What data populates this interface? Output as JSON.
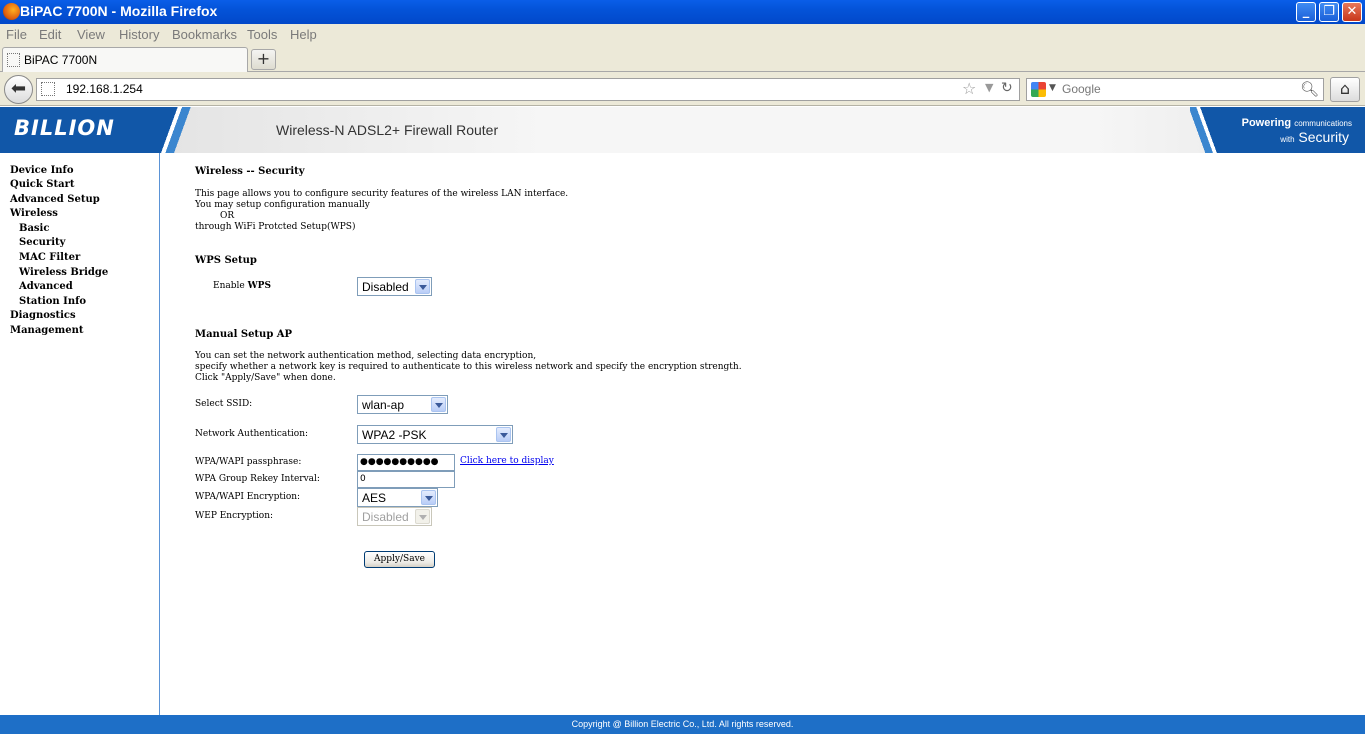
{
  "window": {
    "title": "BiPAC 7700N - Mozilla Firefox"
  },
  "menubar": {
    "items": [
      "File",
      "Edit",
      "View",
      "History",
      "Bookmarks",
      "Tools",
      "Help"
    ]
  },
  "tabs": [
    {
      "label": "BiPAC 7700N"
    }
  ],
  "newtab_label": "+",
  "navbar": {
    "url": "192.168.1.254",
    "search_placeholder": "Google"
  },
  "router": {
    "brand": "BILLION",
    "product": "Wireless-N ADSL2+ Firewall Router",
    "slogan": {
      "powering": "Powering",
      "communications": "communications",
      "with": "with",
      "security": "Security"
    }
  },
  "leftmenu": {
    "items": [
      "Device Info",
      "Quick Start",
      "Advanced Setup",
      "Wireless",
      "Basic",
      "Security",
      "MAC Filter",
      "Wireless Bridge",
      "Advanced",
      "Station Info",
      "Diagnostics",
      "Management"
    ]
  },
  "content": {
    "title": "Wireless -- Security",
    "intro": [
      "This page allows you to configure security features of the wireless LAN interface.",
      "You may setup configuration manually",
      "OR",
      "through WiFi Protcted Setup(WPS)"
    ],
    "wps": {
      "heading": "WPS Setup",
      "enable_label_prefix": "Enable ",
      "enable_label_bold": "WPS",
      "value": "Disabled"
    },
    "manual": {
      "heading": "Manual Setup AP",
      "desc": [
        "You can set the network authentication method, selecting data encryption,",
        "specify whether a network key is required to authenticate to this wireless network and specify the encryption strength.",
        "Click \"Apply/Save\" when done."
      ],
      "ssid_label": "Select SSID:",
      "ssid_value": "wlan-ap",
      "auth_label": "Network Authentication:",
      "auth_value": "WPA2 -PSK",
      "pass_label": "WPA/WAPI passphrase:",
      "pass_value": "●●●●●●●●●●",
      "display_link": "Click here to display",
      "rekey_label": "WPA Group Rekey Interval:",
      "rekey_value": "0",
      "enc_label": "WPA/WAPI Encryption:",
      "enc_value": "AES",
      "wep_label": "WEP Encryption:",
      "wep_value": "Disabled",
      "apply_label": "Apply/Save"
    }
  },
  "footer": "Copyright @ Billion Electric Co., Ltd. All rights reserved."
}
